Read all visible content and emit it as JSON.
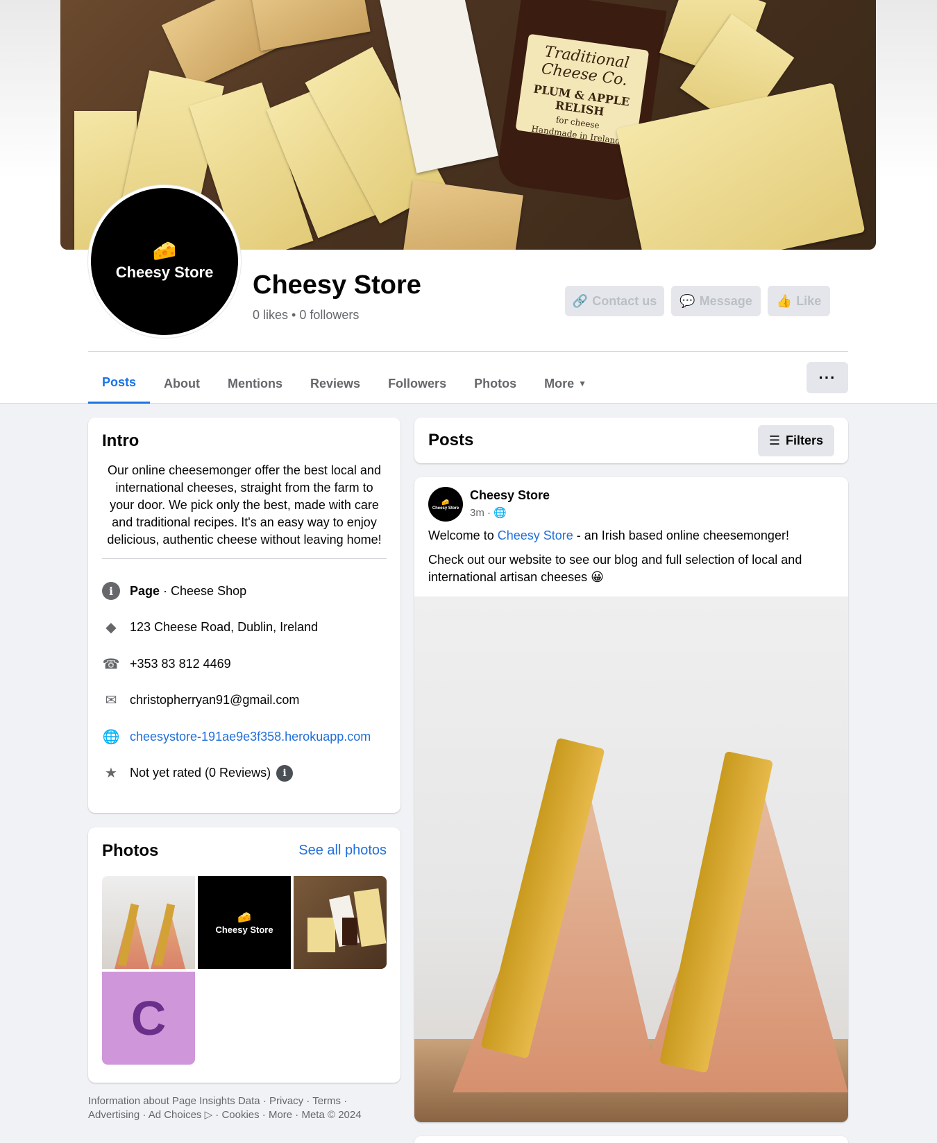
{
  "header": {
    "cover_jar": {
      "brand": "Traditional Cheese Co.",
      "product": "PLUM & APPLE RELISH",
      "subtitle": "for cheese",
      "origin": "Handmade in Ireland"
    },
    "avatar_text": "Cheesy Store",
    "page_name": "Cheesy Store",
    "stats": "0 likes • 0 followers",
    "buttons": {
      "contact": "Contact us",
      "message": "Message",
      "like": "Like"
    },
    "more_dots": "···"
  },
  "tabs": [
    {
      "label": "Posts",
      "active": true
    },
    {
      "label": "About"
    },
    {
      "label": "Mentions"
    },
    {
      "label": "Reviews"
    },
    {
      "label": "Followers"
    },
    {
      "label": "Photos"
    },
    {
      "label": "More"
    }
  ],
  "intro": {
    "title": "Intro",
    "bio": "Our online cheesemonger offer the best local and international cheeses, straight from the farm to your door. We pick only the best, made with care and traditional recipes. It's an easy way to enjoy delicious, authentic cheese without leaving home!",
    "page_label": "Page",
    "category": " · Cheese Shop",
    "address": "123 Cheese Road, Dublin, Ireland",
    "phone": "+353 83 812 4469",
    "email": "christopherryan91@gmail.com",
    "website": "cheesystore-191ae9e3f358.herokuapp.com",
    "rating": "Not yet rated (0 Reviews)"
  },
  "photos": {
    "title": "Photos",
    "see_all": "See all photos",
    "avatar_text": "Cheesy Store",
    "letter_tile": "C"
  },
  "footer": {
    "text": "Information about Page Insights Data · Privacy · Terms · Advertising · Ad Choices ▷ · Cookies · More · Meta © 2024"
  },
  "posts_header": {
    "title": "Posts",
    "filters": "Filters"
  },
  "post": {
    "author": "Cheesy Store",
    "avatar_text": "Cheesy Store",
    "time": "3m ·",
    "line1_prefix": "Welcome to ",
    "line1_link": "Cheesy Store",
    "line1_suffix": " - an Irish based online cheesemonger!",
    "line2": "Check out our website to see our blog and full selection of local and international artisan cheeses 😀"
  },
  "colors": {
    "accent": "#1b74e4",
    "link": "#216fdb",
    "bg": "#f0f2f5"
  }
}
